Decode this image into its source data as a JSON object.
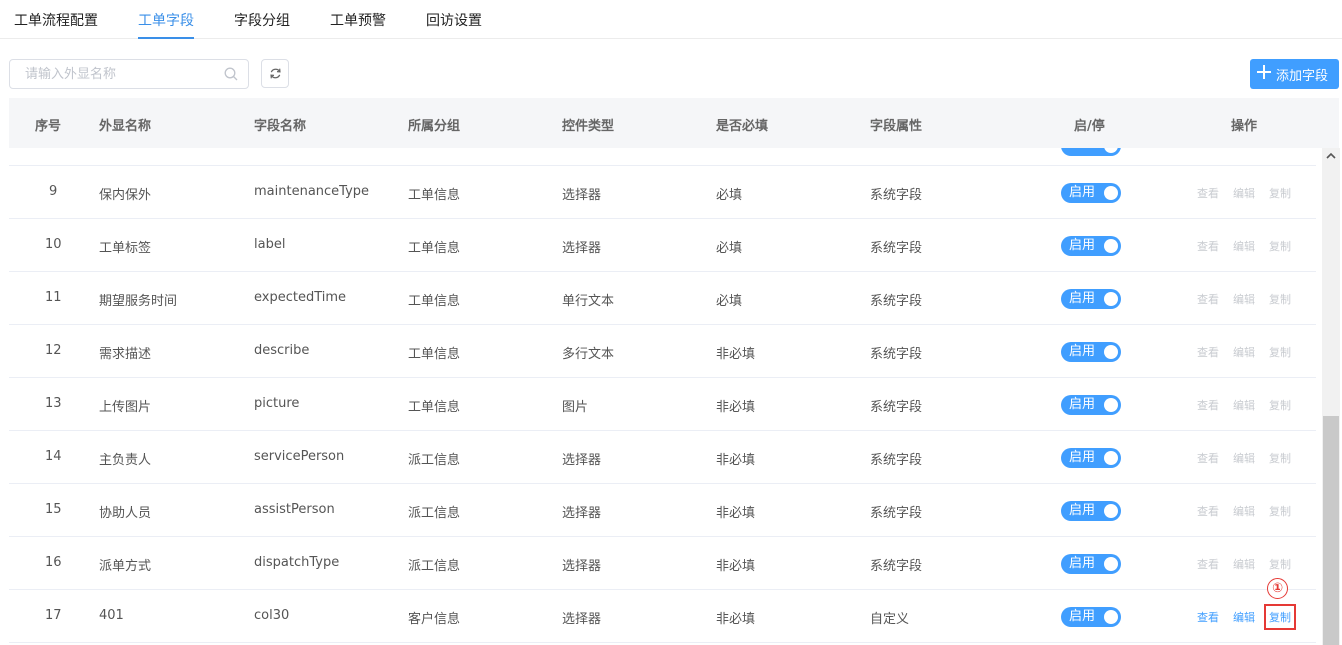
{
  "tabs": [
    {
      "label": "工单流程配置",
      "active": false
    },
    {
      "label": "工单字段",
      "active": true
    },
    {
      "label": "字段分组",
      "active": false
    },
    {
      "label": "工单预警",
      "active": false
    },
    {
      "label": "回访设置",
      "active": false
    }
  ],
  "toolbar": {
    "search_placeholder": "请输入外显名称",
    "search_value": "",
    "add_label": "添加字段"
  },
  "columns": {
    "index": "序号",
    "display_name": "外显名称",
    "field_name": "字段名称",
    "group": "所属分组",
    "control_type": "控件类型",
    "required": "是否必填",
    "attribute": "字段属性",
    "status": "启/停",
    "actions": "操作"
  },
  "action_labels": {
    "view": "查看",
    "edit": "编辑",
    "copy": "复制"
  },
  "rows": [
    {
      "index": "9",
      "display_name": "保内保外",
      "field_name": "maintenanceType",
      "group": "工单信息",
      "control_type": "选择器",
      "required": "必填",
      "attribute": "系统字段",
      "status": "启用",
      "actions_enabled": false
    },
    {
      "index": "10",
      "display_name": "工单标签",
      "field_name": "label",
      "group": "工单信息",
      "control_type": "选择器",
      "required": "必填",
      "attribute": "系统字段",
      "status": "启用",
      "actions_enabled": false
    },
    {
      "index": "11",
      "display_name": "期望服务时间",
      "field_name": "expectedTime",
      "group": "工单信息",
      "control_type": "单行文本",
      "required": "必填",
      "attribute": "系统字段",
      "status": "启用",
      "actions_enabled": false
    },
    {
      "index": "12",
      "display_name": "需求描述",
      "field_name": "describe",
      "group": "工单信息",
      "control_type": "多行文本",
      "required": "非必填",
      "attribute": "系统字段",
      "status": "启用",
      "actions_enabled": false
    },
    {
      "index": "13",
      "display_name": "上传图片",
      "field_name": "picture",
      "group": "工单信息",
      "control_type": "图片",
      "required": "非必填",
      "attribute": "系统字段",
      "status": "启用",
      "actions_enabled": false
    },
    {
      "index": "14",
      "display_name": "主负责人",
      "field_name": "servicePerson",
      "group": "派工信息",
      "control_type": "选择器",
      "required": "非必填",
      "attribute": "系统字段",
      "status": "启用",
      "actions_enabled": false
    },
    {
      "index": "15",
      "display_name": "协助人员",
      "field_name": "assistPerson",
      "group": "派工信息",
      "control_type": "选择器",
      "required": "非必填",
      "attribute": "系统字段",
      "status": "启用",
      "actions_enabled": false
    },
    {
      "index": "16",
      "display_name": "派单方式",
      "field_name": "dispatchType",
      "group": "派工信息",
      "control_type": "选择器",
      "required": "非必填",
      "attribute": "系统字段",
      "status": "启用",
      "actions_enabled": false
    },
    {
      "index": "17",
      "display_name": "401",
      "field_name": "col30",
      "group": "客户信息",
      "control_type": "选择器",
      "required": "非必填",
      "attribute": "自定义",
      "status": "启用",
      "actions_enabled": true
    }
  ],
  "annotation": {
    "marker": "①"
  },
  "colors": {
    "accent": "#409eff",
    "highlight": "#e53935"
  }
}
